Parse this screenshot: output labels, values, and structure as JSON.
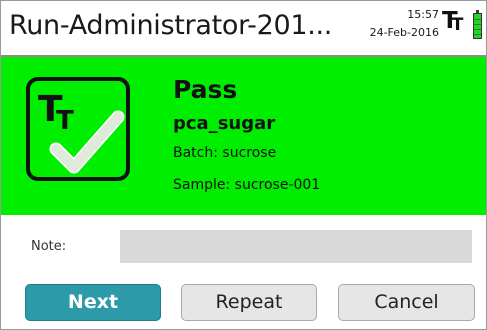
{
  "titlebar": {
    "title": "Run-Administrator-201...",
    "time": "15:57",
    "date": "24-Feb-2016",
    "logo_icon": "tt-logo-icon",
    "battery_icon": "battery-icon"
  },
  "result": {
    "status": "Pass",
    "method": "pca_sugar",
    "batch": "Batch: sucrose",
    "sample": "Sample: sucrose-001",
    "badge_icon": "pass-check-icon",
    "background_color": "#00ee00"
  },
  "note": {
    "label": "Note:",
    "value": "",
    "placeholder": ""
  },
  "buttons": {
    "next": "Next",
    "repeat": "Repeat",
    "cancel": "Cancel",
    "accent_color": "#2c9aa8"
  }
}
